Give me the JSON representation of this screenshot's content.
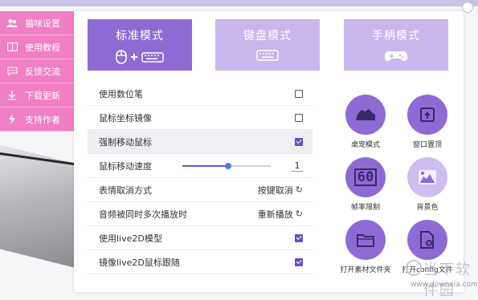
{
  "sidebar": {
    "items": [
      {
        "label": "猫咪设置",
        "icon": "users-icon"
      },
      {
        "label": "使用教程",
        "icon": "book-icon"
      },
      {
        "label": "反馈交流",
        "icon": "chat-icon"
      },
      {
        "label": "下载更新",
        "icon": "download-icon"
      },
      {
        "label": "支持作者",
        "icon": "bolt-icon"
      }
    ]
  },
  "modes": [
    {
      "label": "标准模式",
      "icon": "mouse-keyboard-icon",
      "active": true
    },
    {
      "label": "键盘模式",
      "icon": "keyboard-icon",
      "active": false
    },
    {
      "label": "手柄模式",
      "icon": "gamepad-icon",
      "active": false
    }
  ],
  "settings": {
    "use_pen": {
      "label": "使用数位笔",
      "checked": false
    },
    "mirror_mouse": {
      "label": "鼠标坐标镜像",
      "checked": false
    },
    "force_move": {
      "label": "强制移动鼠标",
      "checked": true
    },
    "mouse_speed": {
      "label": "鼠标移动速度",
      "value": "1",
      "fraction": 0.52
    },
    "expression_cancel": {
      "label": "表情取消方式",
      "value": "按键取消"
    },
    "audio_multi": {
      "label": "音频被同时多次播放时",
      "value": "重新播放"
    },
    "live2d": {
      "label": "使用live2D模型",
      "checked": true
    },
    "live2d_mirror": {
      "label": "镜像live2D鼠标跟随",
      "checked": true
    }
  },
  "round_buttons": [
    {
      "label": "桌宠模式",
      "icon": "desk-pet-icon"
    },
    {
      "label": "窗口置顶",
      "icon": "pin-top-icon"
    },
    {
      "label": "帧率限制",
      "icon": "fps-icon",
      "text": "60"
    },
    {
      "label": "背景色",
      "icon": "background-color-icon"
    },
    {
      "label": "打开素材文件夹",
      "icon": "folder-icon"
    },
    {
      "label": "打开config文件",
      "icon": "config-file-icon"
    }
  ],
  "watermark": {
    "cn": "当下软件园",
    "url": "www.downxia.com"
  },
  "colors": {
    "accent": "#8e6bd4",
    "accent_light": "#c9b6ec",
    "sidebar": "#f07fc3",
    "checkbox": "#6d4fc2"
  }
}
